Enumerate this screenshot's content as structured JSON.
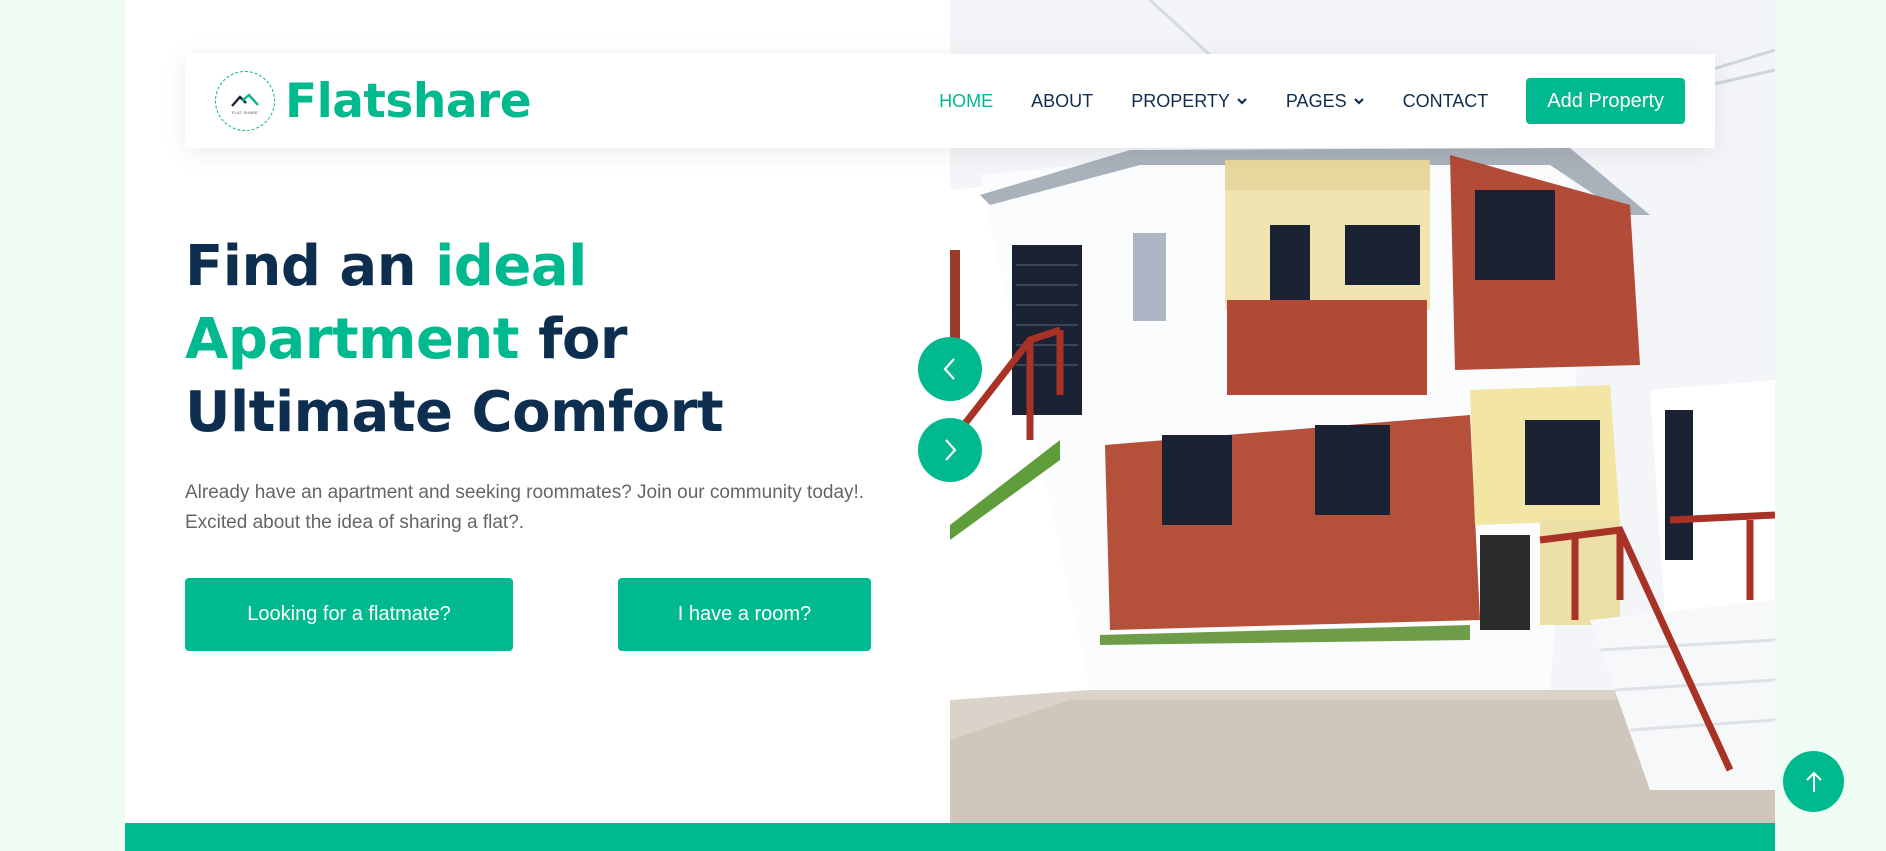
{
  "brand": {
    "name": "Flatshare",
    "logo_icon": "house-roof-icon",
    "logo_caption": "FLAT SHARE"
  },
  "nav": {
    "items": [
      {
        "label": "HOME",
        "active": true,
        "dropdown": false
      },
      {
        "label": "ABOUT",
        "active": false,
        "dropdown": false
      },
      {
        "label": "PROPERTY",
        "active": false,
        "dropdown": true
      },
      {
        "label": "PAGES",
        "active": false,
        "dropdown": true
      },
      {
        "label": "CONTACT",
        "active": false,
        "dropdown": false
      }
    ],
    "cta_label": "Add Property"
  },
  "hero": {
    "title_part1": "Find an ",
    "title_accent": "ideal Apartment",
    "title_part2": " for Ultimate Comfort",
    "description": "Already have an apartment and seeking roommates? Join our community today!. Excited about the idea of sharing a flat?.",
    "button_flatmate": "Looking for a flatmate?",
    "button_room": "I have a room?",
    "image_subject": "two-storey white and red-brick house with red stair railings"
  },
  "colors": {
    "accent": "#00b98e",
    "heading": "#0e2e50",
    "body_text": "#666565",
    "page_background": "#eefcf4"
  },
  "icons": {
    "carousel_prev": "chevron-left-icon",
    "carousel_next": "chevron-right-icon",
    "back_to_top": "arrow-up-icon"
  }
}
